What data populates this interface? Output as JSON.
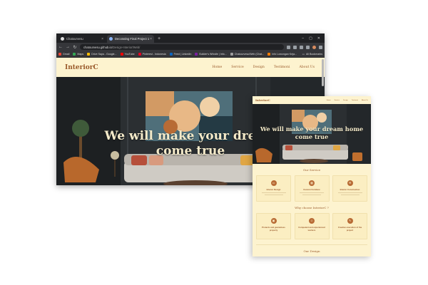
{
  "browser": {
    "tabs": [
      {
        "label": "Chatourvesu",
        "active": false
      },
      {
        "label": "Decorating Final Project 1",
        "active": true
      }
    ],
    "url": {
      "host": "chatourvesu.github.io",
      "path": "/Design-Interior/Web/"
    },
    "bookmarks": [
      {
        "label": "Gmail",
        "color": "#ea4335"
      },
      {
        "label": "Maps",
        "color": "#34a853"
      },
      {
        "label": "Drive Saya - Google...",
        "color": "#fbbc05"
      },
      {
        "label": "YouTube",
        "color": "#ff0000"
      },
      {
        "label": "Pinterest - Indonesia",
        "color": "#e60023"
      },
      {
        "label": "Feed | LinkedIn",
        "color": "#0a66c2"
      },
      {
        "label": "Builder's Whistle | Info...",
        "color": "#7b1fa2"
      },
      {
        "label": "Chatourvesu/Web (Chat...",
        "color": "#9e9e9e"
      },
      {
        "label": "Info Lowongan Keja...",
        "color": "#f57c00"
      }
    ],
    "all_bookmarks_label": "All Bookmarks"
  },
  "site": {
    "brand": "InteriorC",
    "menu": [
      "Home",
      "Service",
      "Design",
      "Testimoni",
      "About Us"
    ],
    "hero_title_line1": "We will make your dream",
    "hero_title_line2": "come true"
  },
  "mobile": {
    "brand": "InteriorC",
    "menu": [
      "Home",
      "Service",
      "Design",
      "Testimoni",
      "About Us"
    ],
    "hero_title_line1": "We will make your dream home",
    "hero_title_line2": "come true",
    "service_title": "Our Service",
    "services": [
      {
        "title": "Interior Design",
        "icon": "sofa-icon",
        "glyph": "▭"
      },
      {
        "title": "Custom Furniture",
        "icon": "cabinet-icon",
        "glyph": "▦"
      },
      {
        "title": "Interior Construction",
        "icon": "hammer-icon",
        "glyph": "⚒"
      }
    ],
    "why_title": "Why choose InteriorC ?",
    "reasons": [
      {
        "title": "Protects and guarantees property",
        "icon": "shield-icon",
        "glyph": "▣"
      },
      {
        "title": "Competent and experienced workers",
        "icon": "worker-icon",
        "glyph": "☺"
      },
      {
        "title": "Creative execution of the project",
        "icon": "palette-icon",
        "glyph": "✎"
      }
    ],
    "design_title": "Our Design"
  },
  "colors": {
    "cream": "#fdf3cf",
    "brown": "#9a5a2b",
    "accent": "#b86b35"
  }
}
